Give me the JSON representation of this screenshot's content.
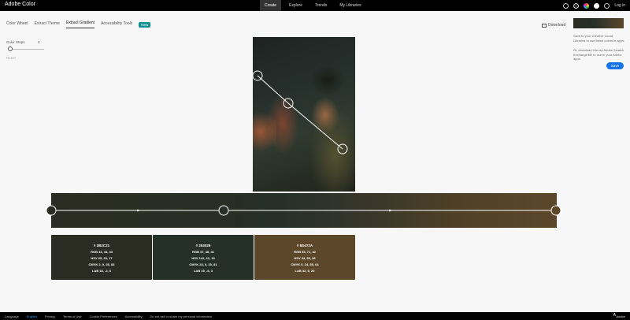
{
  "header": {
    "brand": "Adobe Color",
    "nav": [
      "Create",
      "Explore",
      "Trends",
      "My Libraries"
    ],
    "active_nav": 0,
    "login": "Log in"
  },
  "tabs": {
    "items": [
      "Color Wheel",
      "Extract Theme",
      "Extract Gradient",
      "Accessibility Tools"
    ],
    "active": 2,
    "badge": "New"
  },
  "download": "Download",
  "controls": {
    "label": "Color Stops",
    "value": "4",
    "reset": "Reset"
  },
  "swatches": [
    {
      "hex": "# 2B2C21",
      "rgb": "RGB 43, 44, 33",
      "hsv": "HSV 65, 25, 17",
      "cmyk": "CMYK 2, 0, 25, 83",
      "lab": "LAB 18, -2, 6",
      "color": "#2b2c21"
    },
    {
      "hex": "# 253029",
      "rgb": "RGB 37, 48, 41",
      "hsv": "HSV 142, 22, 19",
      "cmyk": "CMYK 23, 0, 15, 81",
      "lab": "LAB 19, -6, 3",
      "color": "#253029"
    },
    {
      "hex": "# 5D472A",
      "rgb": "RGB 93, 71, 42",
      "hsv": "HSV 34, 55, 36",
      "cmyk": "CMYK 0, 24, 55, 64",
      "lab": "LAB 32, 5, 20",
      "color": "#5d472a"
    }
  ],
  "right_panel": {
    "text1": "Save to your Creative Cloud Libraries to use these colors in apps.",
    "text2": "Or, download it as an Adobe Swatch Exchange file to use in your Adobe apps.",
    "button": "Save"
  },
  "footer": {
    "links": [
      "Language",
      "English",
      "Privacy",
      "Terms of Use",
      "Cookie Preferences",
      "Accessibility",
      "Do not sell or share my personal information"
    ],
    "adobe": "Adobe"
  }
}
